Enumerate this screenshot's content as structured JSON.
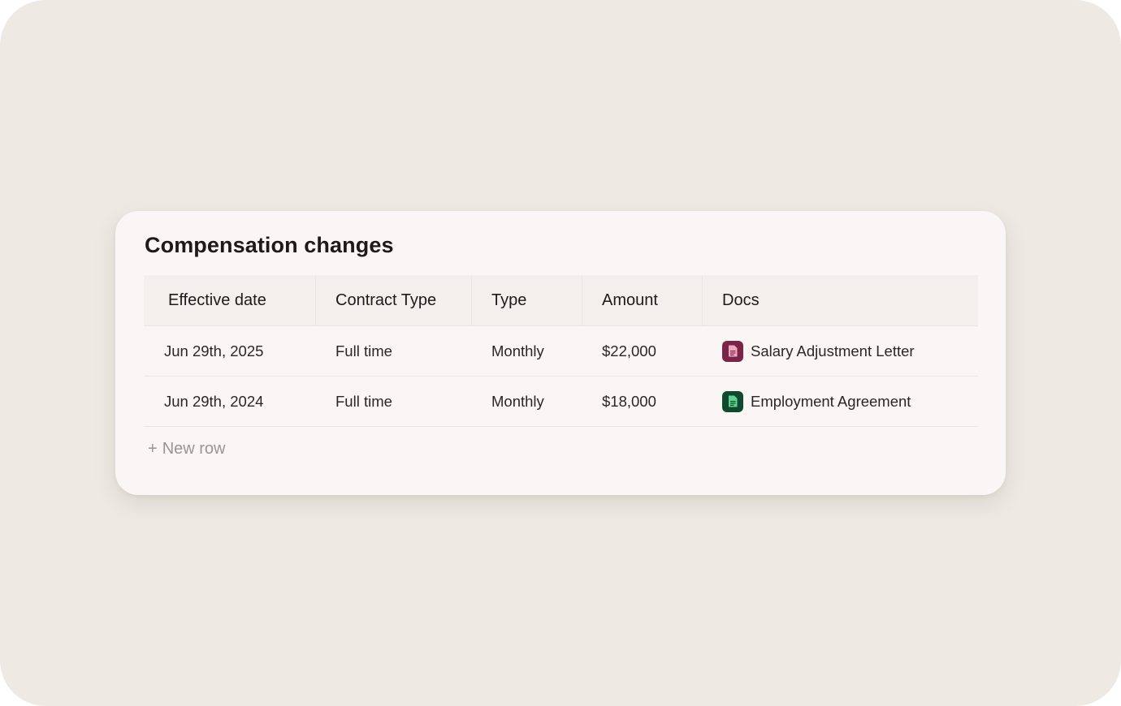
{
  "card": {
    "title": "Compensation changes"
  },
  "table": {
    "columns": [
      "Effective date",
      "Contract Type",
      "Type",
      "Amount",
      "Docs"
    ],
    "rows": [
      {
        "effective_date": "Jun 29th, 2025",
        "contract_type": "Full time",
        "type": "Monthly",
        "amount": "$22,000",
        "doc": {
          "label": "Salary Adjustment Letter",
          "icon": "document-icon",
          "color": "#7a2447",
          "glyph_color": "#f0a6c2"
        }
      },
      {
        "effective_date": "Jun 29th, 2024",
        "contract_type": "Full time",
        "type": "Monthly",
        "amount": "$18,000",
        "doc": {
          "label": "Employment Agreement",
          "icon": "document-icon",
          "color": "#0f4a2e",
          "glyph_color": "#5fd08e"
        }
      }
    ]
  },
  "new_row": {
    "plus": "+",
    "label": "New row"
  },
  "colors": {
    "background": "#eee9e3",
    "card": "#f9f6f5",
    "header_row": "#f3efed",
    "text": "#1d1b19",
    "muted": "#9a9592"
  }
}
